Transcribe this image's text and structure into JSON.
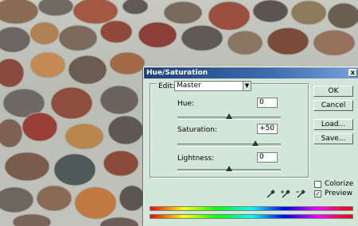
{
  "dialog": {
    "title": "Hue/Saturation",
    "close_glyph": "x",
    "edit_label": "Edit:",
    "edit_value": "Master",
    "hue_label": "Hue:",
    "hue_value": "0",
    "hue_level": 0.5,
    "saturation_label": "Saturation:",
    "saturation_value": "+50",
    "saturation_level": 0.75,
    "lightness_label": "Lightness:",
    "lightness_value": "0",
    "lightness_level": 0.5,
    "buttons": {
      "ok": "OK",
      "cancel": "Cancel",
      "load": "Load...",
      "save": "Save..."
    },
    "colorize_label": "Colorize",
    "colorize_checked": false,
    "preview_label": "Preview",
    "preview_checked": true,
    "colors": {
      "panel": "#d4e6d9",
      "titlebar": "#1f3f7a"
    }
  },
  "icons": [
    "eyedropper-icon",
    "eyedropper-plus-icon",
    "eyedropper-minus-icon"
  ]
}
